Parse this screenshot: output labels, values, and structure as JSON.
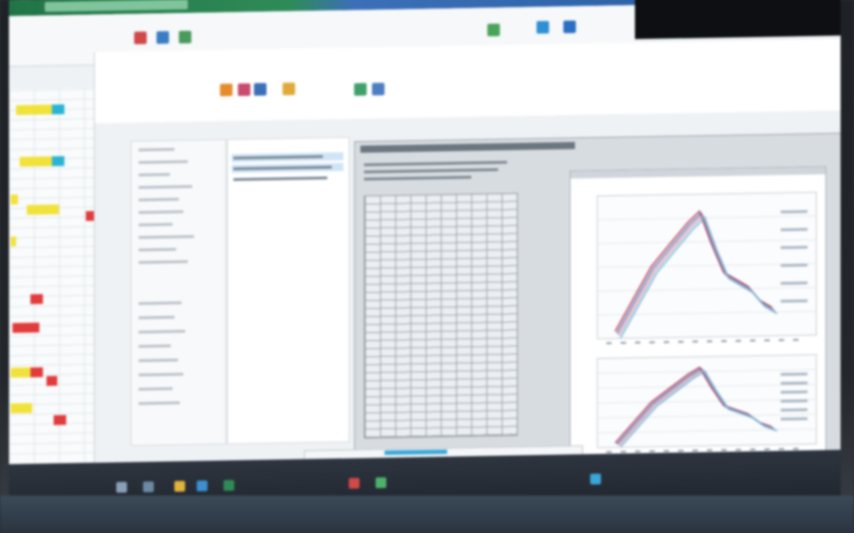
{
  "colors": {
    "excel_green": "#227447",
    "accent_blue": "#3aa7d8",
    "selection_blue": "#cfe4f7",
    "series_red": "#b5344a",
    "series_blue": "#4b6fb0",
    "series_pink": "#e08ca2",
    "series_cyan": "#63b5d6",
    "highlight_yellow": "#f1e23a",
    "highlight_cyan": "#2ab3d6",
    "highlight_red": "#e23b3b"
  },
  "excel": {
    "ribbon_icons": [
      "insert-icon",
      "chart-icon",
      "format-icon",
      "filter-icon",
      "sort-icon",
      "share-icon"
    ]
  },
  "app": {
    "ribbon_icons": [
      "paste-icon",
      "cut-icon",
      "color-icon",
      "settings-icon",
      "export-icon",
      "print-icon"
    ]
  },
  "report": {
    "charts": [
      {
        "series_count": 4,
        "legend_entries": 6
      },
      {
        "series_count": 4,
        "legend_entries": 6
      }
    ]
  },
  "taskbar": {
    "icons": [
      "start-icon",
      "search-icon",
      "explorer-icon",
      "browser-icon",
      "excel-icon",
      "mail-icon",
      "chat-icon",
      "settings-icon"
    ]
  }
}
